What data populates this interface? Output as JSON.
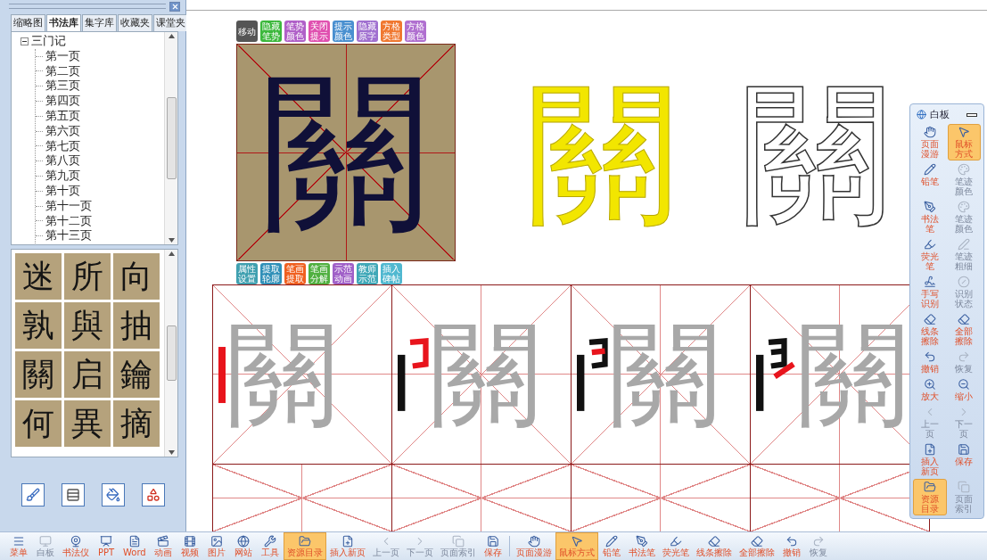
{
  "left_panel": {
    "tabs": [
      {
        "label": "缩略图",
        "selected": false
      },
      {
        "label": "书法库",
        "selected": true
      },
      {
        "label": "集字库",
        "selected": false
      },
      {
        "label": "收藏夹",
        "selected": false
      },
      {
        "label": "课堂夹",
        "selected": false
      }
    ],
    "tree": [
      {
        "label": "三门记",
        "expanded": true,
        "children": [
          {
            "label": "第一页"
          },
          {
            "label": "第二页"
          },
          {
            "label": "第三页"
          },
          {
            "label": "第四页"
          },
          {
            "label": "第五页"
          },
          {
            "label": "第六页"
          },
          {
            "label": "第七页"
          },
          {
            "label": "第八页"
          },
          {
            "label": "第九页"
          },
          {
            "label": "第十页"
          },
          {
            "label": "第十一页"
          },
          {
            "label": "第十二页"
          },
          {
            "label": "第十三页"
          }
        ]
      }
    ],
    "character_tiles": [
      "迷",
      "所",
      "向",
      "孰",
      "與",
      "抽",
      "關",
      "启",
      "鑰",
      "何",
      "異",
      "摘"
    ]
  },
  "editor": {
    "top_buttons": [
      {
        "label": "移动",
        "color": "#555555"
      },
      {
        "label": "隐藏笔势",
        "color": "#3cb83c"
      },
      {
        "label": "笔势颜色",
        "color": "#b060c8"
      },
      {
        "label": "关闭提示",
        "color": "#e050b0"
      },
      {
        "label": "提示颜色",
        "color": "#4a90d0"
      },
      {
        "label": "隐藏原字",
        "color": "#a070d0"
      },
      {
        "label": "方格类型",
        "color": "#f07830"
      },
      {
        "label": "方格颜色",
        "color": "#b070d0"
      }
    ],
    "sample_character": "關",
    "bottom_buttons": [
      {
        "label": "属性设置",
        "color": "#40a0b0"
      },
      {
        "label": "提取轮廓",
        "color": "#3090b8"
      },
      {
        "label": "笔画提取",
        "color": "#f06020"
      },
      {
        "label": "笔画分解",
        "color": "#50b040"
      },
      {
        "label": "示范动画",
        "color": "#a060c8"
      },
      {
        "label": "教师示范",
        "color": "#40a8b8"
      },
      {
        "label": "插入碑帖",
        "color": "#50b8d0"
      }
    ],
    "previews": [
      {
        "kind": "filled",
        "char": "關"
      },
      {
        "kind": "outline",
        "char": "關"
      }
    ],
    "practice_cells": [
      "關",
      "關",
      "關",
      "關"
    ]
  },
  "whiteboard": {
    "title": "白板",
    "tools": [
      {
        "label": "页面漫游",
        "selected": false,
        "disabled": false
      },
      {
        "label": "鼠标方式",
        "selected": true,
        "disabled": false
      },
      {
        "label": "铅笔",
        "selected": false,
        "disabled": false
      },
      {
        "label": "笔迹颜色",
        "selected": false,
        "disabled": true
      },
      {
        "label": "书法笔",
        "selected": false,
        "disabled": false
      },
      {
        "label": "笔迹颜色",
        "selected": false,
        "disabled": true
      },
      {
        "label": "荧光笔",
        "selected": false,
        "disabled": false
      },
      {
        "label": "笔迹粗细",
        "selected": false,
        "disabled": true
      },
      {
        "label": "手写识别",
        "selected": false,
        "disabled": false
      },
      {
        "label": "识别状态",
        "selected": false,
        "disabled": true
      },
      {
        "label": "线条擦除",
        "selected": false,
        "disabled": false
      },
      {
        "label": "全部擦除",
        "selected": false,
        "disabled": false
      },
      {
        "label": "撤销",
        "selected": false,
        "disabled": false
      },
      {
        "label": "恢复",
        "selected": false,
        "disabled": true
      },
      {
        "label": "放大",
        "selected": false,
        "disabled": false
      },
      {
        "label": "缩小",
        "selected": false,
        "disabled": false
      },
      {
        "label": "上一页",
        "selected": false,
        "disabled": true
      },
      {
        "label": "下一页",
        "selected": false,
        "disabled": true
      },
      {
        "label": "插入新页",
        "selected": false,
        "disabled": false
      },
      {
        "label": "保存",
        "selected": false,
        "disabled": false
      },
      {
        "label": "资源目录",
        "selected": true,
        "disabled": false
      },
      {
        "label": "页面索引",
        "selected": false,
        "disabled": true
      }
    ]
  },
  "taskbar": [
    {
      "label": "菜单",
      "selected": false,
      "disabled": false
    },
    {
      "label": "白板",
      "selected": false,
      "disabled": true
    },
    {
      "label": "书法仪",
      "selected": false,
      "disabled": false
    },
    {
      "label": "PPT",
      "selected": false,
      "disabled": false
    },
    {
      "label": "Word",
      "selected": false,
      "disabled": false
    },
    {
      "label": "动画",
      "selected": false,
      "disabled": false
    },
    {
      "label": "视频",
      "selected": false,
      "disabled": false
    },
    {
      "label": "图片",
      "selected": false,
      "disabled": false
    },
    {
      "label": "网站",
      "selected": false,
      "disabled": false
    },
    {
      "label": "工具",
      "selected": false,
      "disabled": false
    },
    {
      "label": "资源目录",
      "selected": true,
      "disabled": false
    },
    {
      "label": "插入新页",
      "selected": false,
      "disabled": false
    },
    {
      "label": "上一页",
      "selected": false,
      "disabled": true
    },
    {
      "label": "下一页",
      "selected": false,
      "disabled": true
    },
    {
      "label": "页面索引",
      "selected": false,
      "disabled": true
    },
    {
      "label": "保存",
      "selected": false,
      "disabled": false
    },
    {
      "label": "页面漫游",
      "selected": false,
      "disabled": false
    },
    {
      "label": "鼠标方式",
      "selected": true,
      "disabled": false
    },
    {
      "label": "铅笔",
      "selected": false,
      "disabled": false
    },
    {
      "label": "书法笔",
      "selected": false,
      "disabled": false
    },
    {
      "label": "荧光笔",
      "selected": false,
      "disabled": false
    },
    {
      "label": "线条擦除",
      "selected": false,
      "disabled": false
    },
    {
      "label": "全部擦除",
      "selected": false,
      "disabled": false
    },
    {
      "label": "撤销",
      "selected": false,
      "disabled": false
    },
    {
      "label": "恢复",
      "selected": false,
      "disabled": true
    }
  ]
}
